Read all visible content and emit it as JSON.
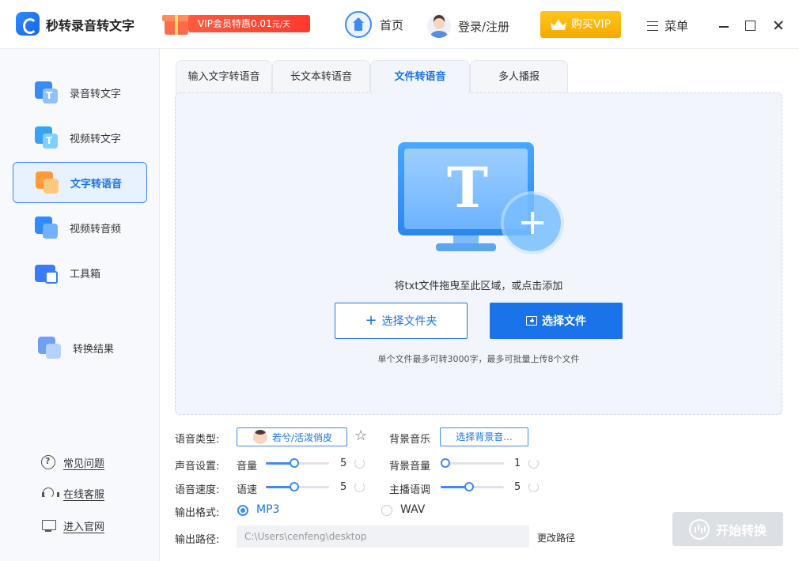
{
  "app": {
    "title": "秒转录音转文字",
    "promo_text": "VIP会员特惠0.01",
    "promo_unit": "元/天"
  },
  "header": {
    "home_label": "首页",
    "login_label": "登录/注册",
    "buy_vip_label": "购买VIP",
    "menu_label": "菜单"
  },
  "sidebar": {
    "items": [
      {
        "label": "录音转文字",
        "icon": "audio-to-text-icon"
      },
      {
        "label": "视频转文字",
        "icon": "video-to-text-icon"
      },
      {
        "label": "文字转语音",
        "icon": "text-to-speech-icon",
        "active": true
      },
      {
        "label": "视频转音频",
        "icon": "video-to-audio-icon"
      },
      {
        "label": "工具箱",
        "icon": "toolbox-icon"
      },
      {
        "label": "转换结果",
        "icon": "results-icon"
      }
    ],
    "help": [
      {
        "label": "常见问题",
        "icon": "question-icon"
      },
      {
        "label": "在线客服",
        "icon": "headset-icon"
      },
      {
        "label": "进入官网",
        "icon": "monitor-icon"
      }
    ]
  },
  "tabs": [
    {
      "label": "输入文字转语音"
    },
    {
      "label": "长文本转语音"
    },
    {
      "label": "文件转语音",
      "active": true
    },
    {
      "label": "多人播报"
    }
  ],
  "dropzone": {
    "icon_letter": "T",
    "hint": "将txt文件拖曳至此区域，或点击添加",
    "folder_button": "选择文件夹",
    "file_button": "选择文件",
    "limit_note": "单个文件最多可转3000字，最多可批量上传8个文件"
  },
  "settings": {
    "voice_type_label": "语音类型:",
    "voice_name": "若兮/活泼俏皮",
    "bgm_label": "背景音乐",
    "bgm_button": "选择背景音...",
    "sound_label": "声音设置:",
    "volume_label": "音量",
    "volume_value": "5",
    "volume_fraction": 0.45,
    "bg_volume_label": "背景音量",
    "bg_volume_value": "1",
    "bg_volume_fraction": 0.0,
    "speed_section_label": "语音速度:",
    "speed_label": "语速",
    "speed_value": "5",
    "speed_fraction": 0.45,
    "tone_label": "主播语调",
    "tone_value": "5",
    "tone_fraction": 0.45,
    "format_label": "输出格式:",
    "format_options": [
      "MP3",
      "WAV"
    ],
    "format_selected": "MP3",
    "path_label": "输出路径:",
    "path_value": "C:\\Users\\cenfeng\\desktop",
    "change_path": "更改路径"
  },
  "start_button": "开始转换",
  "colors": {
    "accent": "#1a73e8",
    "promo": "#ff3a2e",
    "vip_gold": "#f7a800",
    "disabled": "#dcdfe4"
  }
}
